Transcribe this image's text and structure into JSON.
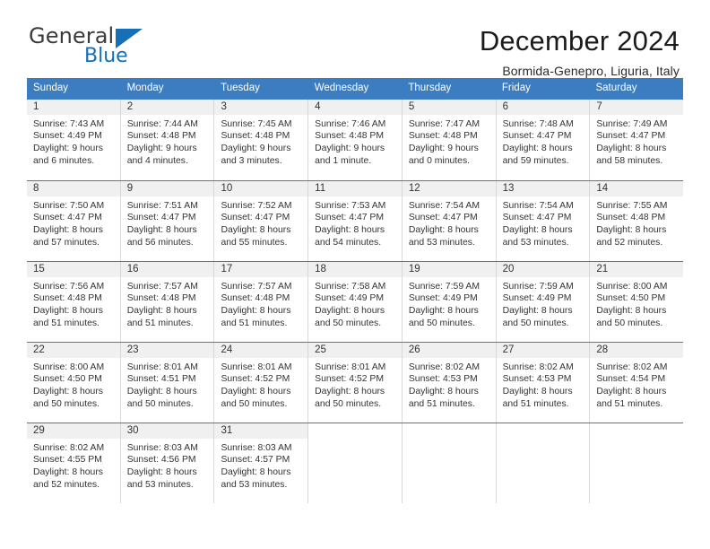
{
  "brand": {
    "name_part1": "General",
    "name_part2": "Blue",
    "triangle_icon": "triangle-icon",
    "colors": {
      "text": "#3b3b3b",
      "accent": "#1570b8"
    }
  },
  "header": {
    "title": "December 2024",
    "subtitle": "Bormida-Genepro, Liguria, Italy"
  },
  "calendar": {
    "header_bg": "#3b7dc0",
    "day_band_bg": "#f0f0f0",
    "weekdays": [
      "Sunday",
      "Monday",
      "Tuesday",
      "Wednesday",
      "Thursday",
      "Friday",
      "Saturday"
    ],
    "weeks": [
      [
        {
          "day": "1",
          "sunrise": "Sunrise: 7:43 AM",
          "sunset": "Sunset: 4:49 PM",
          "daylight_line1": "Daylight: 9 hours",
          "daylight_line2": "and 6 minutes."
        },
        {
          "day": "2",
          "sunrise": "Sunrise: 7:44 AM",
          "sunset": "Sunset: 4:48 PM",
          "daylight_line1": "Daylight: 9 hours",
          "daylight_line2": "and 4 minutes."
        },
        {
          "day": "3",
          "sunrise": "Sunrise: 7:45 AM",
          "sunset": "Sunset: 4:48 PM",
          "daylight_line1": "Daylight: 9 hours",
          "daylight_line2": "and 3 minutes."
        },
        {
          "day": "4",
          "sunrise": "Sunrise: 7:46 AM",
          "sunset": "Sunset: 4:48 PM",
          "daylight_line1": "Daylight: 9 hours",
          "daylight_line2": "and 1 minute."
        },
        {
          "day": "5",
          "sunrise": "Sunrise: 7:47 AM",
          "sunset": "Sunset: 4:48 PM",
          "daylight_line1": "Daylight: 9 hours",
          "daylight_line2": "and 0 minutes."
        },
        {
          "day": "6",
          "sunrise": "Sunrise: 7:48 AM",
          "sunset": "Sunset: 4:47 PM",
          "daylight_line1": "Daylight: 8 hours",
          "daylight_line2": "and 59 minutes."
        },
        {
          "day": "7",
          "sunrise": "Sunrise: 7:49 AM",
          "sunset": "Sunset: 4:47 PM",
          "daylight_line1": "Daylight: 8 hours",
          "daylight_line2": "and 58 minutes."
        }
      ],
      [
        {
          "day": "8",
          "sunrise": "Sunrise: 7:50 AM",
          "sunset": "Sunset: 4:47 PM",
          "daylight_line1": "Daylight: 8 hours",
          "daylight_line2": "and 57 minutes."
        },
        {
          "day": "9",
          "sunrise": "Sunrise: 7:51 AM",
          "sunset": "Sunset: 4:47 PM",
          "daylight_line1": "Daylight: 8 hours",
          "daylight_line2": "and 56 minutes."
        },
        {
          "day": "10",
          "sunrise": "Sunrise: 7:52 AM",
          "sunset": "Sunset: 4:47 PM",
          "daylight_line1": "Daylight: 8 hours",
          "daylight_line2": "and 55 minutes."
        },
        {
          "day": "11",
          "sunrise": "Sunrise: 7:53 AM",
          "sunset": "Sunset: 4:47 PM",
          "daylight_line1": "Daylight: 8 hours",
          "daylight_line2": "and 54 minutes."
        },
        {
          "day": "12",
          "sunrise": "Sunrise: 7:54 AM",
          "sunset": "Sunset: 4:47 PM",
          "daylight_line1": "Daylight: 8 hours",
          "daylight_line2": "and 53 minutes."
        },
        {
          "day": "13",
          "sunrise": "Sunrise: 7:54 AM",
          "sunset": "Sunset: 4:47 PM",
          "daylight_line1": "Daylight: 8 hours",
          "daylight_line2": "and 53 minutes."
        },
        {
          "day": "14",
          "sunrise": "Sunrise: 7:55 AM",
          "sunset": "Sunset: 4:48 PM",
          "daylight_line1": "Daylight: 8 hours",
          "daylight_line2": "and 52 minutes."
        }
      ],
      [
        {
          "day": "15",
          "sunrise": "Sunrise: 7:56 AM",
          "sunset": "Sunset: 4:48 PM",
          "daylight_line1": "Daylight: 8 hours",
          "daylight_line2": "and 51 minutes."
        },
        {
          "day": "16",
          "sunrise": "Sunrise: 7:57 AM",
          "sunset": "Sunset: 4:48 PM",
          "daylight_line1": "Daylight: 8 hours",
          "daylight_line2": "and 51 minutes."
        },
        {
          "day": "17",
          "sunrise": "Sunrise: 7:57 AM",
          "sunset": "Sunset: 4:48 PM",
          "daylight_line1": "Daylight: 8 hours",
          "daylight_line2": "and 51 minutes."
        },
        {
          "day": "18",
          "sunrise": "Sunrise: 7:58 AM",
          "sunset": "Sunset: 4:49 PM",
          "daylight_line1": "Daylight: 8 hours",
          "daylight_line2": "and 50 minutes."
        },
        {
          "day": "19",
          "sunrise": "Sunrise: 7:59 AM",
          "sunset": "Sunset: 4:49 PM",
          "daylight_line1": "Daylight: 8 hours",
          "daylight_line2": "and 50 minutes."
        },
        {
          "day": "20",
          "sunrise": "Sunrise: 7:59 AM",
          "sunset": "Sunset: 4:49 PM",
          "daylight_line1": "Daylight: 8 hours",
          "daylight_line2": "and 50 minutes."
        },
        {
          "day": "21",
          "sunrise": "Sunrise: 8:00 AM",
          "sunset": "Sunset: 4:50 PM",
          "daylight_line1": "Daylight: 8 hours",
          "daylight_line2": "and 50 minutes."
        }
      ],
      [
        {
          "day": "22",
          "sunrise": "Sunrise: 8:00 AM",
          "sunset": "Sunset: 4:50 PM",
          "daylight_line1": "Daylight: 8 hours",
          "daylight_line2": "and 50 minutes."
        },
        {
          "day": "23",
          "sunrise": "Sunrise: 8:01 AM",
          "sunset": "Sunset: 4:51 PM",
          "daylight_line1": "Daylight: 8 hours",
          "daylight_line2": "and 50 minutes."
        },
        {
          "day": "24",
          "sunrise": "Sunrise: 8:01 AM",
          "sunset": "Sunset: 4:52 PM",
          "daylight_line1": "Daylight: 8 hours",
          "daylight_line2": "and 50 minutes."
        },
        {
          "day": "25",
          "sunrise": "Sunrise: 8:01 AM",
          "sunset": "Sunset: 4:52 PM",
          "daylight_line1": "Daylight: 8 hours",
          "daylight_line2": "and 50 minutes."
        },
        {
          "day": "26",
          "sunrise": "Sunrise: 8:02 AM",
          "sunset": "Sunset: 4:53 PM",
          "daylight_line1": "Daylight: 8 hours",
          "daylight_line2": "and 51 minutes."
        },
        {
          "day": "27",
          "sunrise": "Sunrise: 8:02 AM",
          "sunset": "Sunset: 4:53 PM",
          "daylight_line1": "Daylight: 8 hours",
          "daylight_line2": "and 51 minutes."
        },
        {
          "day": "28",
          "sunrise": "Sunrise: 8:02 AM",
          "sunset": "Sunset: 4:54 PM",
          "daylight_line1": "Daylight: 8 hours",
          "daylight_line2": "and 51 minutes."
        }
      ],
      [
        {
          "day": "29",
          "sunrise": "Sunrise: 8:02 AM",
          "sunset": "Sunset: 4:55 PM",
          "daylight_line1": "Daylight: 8 hours",
          "daylight_line2": "and 52 minutes."
        },
        {
          "day": "30",
          "sunrise": "Sunrise: 8:03 AM",
          "sunset": "Sunset: 4:56 PM",
          "daylight_line1": "Daylight: 8 hours",
          "daylight_line2": "and 53 minutes."
        },
        {
          "day": "31",
          "sunrise": "Sunrise: 8:03 AM",
          "sunset": "Sunset: 4:57 PM",
          "daylight_line1": "Daylight: 8 hours",
          "daylight_line2": "and 53 minutes."
        },
        {
          "day": "",
          "sunrise": "",
          "sunset": "",
          "daylight_line1": "",
          "daylight_line2": ""
        },
        {
          "day": "",
          "sunrise": "",
          "sunset": "",
          "daylight_line1": "",
          "daylight_line2": ""
        },
        {
          "day": "",
          "sunrise": "",
          "sunset": "",
          "daylight_line1": "",
          "daylight_line2": ""
        },
        {
          "day": "",
          "sunrise": "",
          "sunset": "",
          "daylight_line1": "",
          "daylight_line2": ""
        }
      ]
    ]
  }
}
